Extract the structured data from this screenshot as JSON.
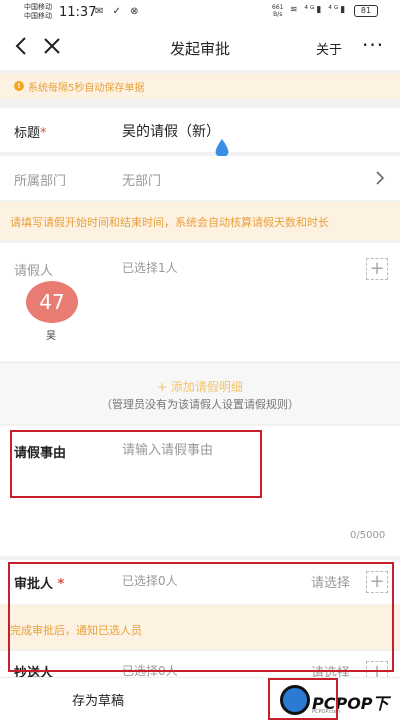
{
  "status_bar": {
    "carrier_1": "中国移动",
    "carrier_2": "中国移动",
    "time": "11:37",
    "speed_value": "661",
    "speed_unit": "B/s",
    "battery": "81"
  },
  "navbar": {
    "title": "发起审批",
    "about": "关于",
    "more": "···"
  },
  "autosave_notice": "系统每隔5秒自动保存单据",
  "form": {
    "title_label": "标题",
    "title_required": "*",
    "title_value": "吴的请假（新）",
    "dept_label": "所属部门",
    "dept_value": "无部门",
    "leave_hint": "请填写请假开始时间和结束时间，系统会自动核算请假天数和时长",
    "applicant_label": "请假人",
    "applicant_selected": "已选择1人",
    "avatar_number": "47",
    "avatar_name": "吴",
    "add_detail": "+ 添加请假明细",
    "add_detail_note": "（管理员没有为该请假人设置请假规则）",
    "reason_label": "请假事由",
    "reason_placeholder": "请输入请假事由",
    "reason_counter": "0/5000",
    "approver_label": "审批人",
    "approver_required": "*",
    "approver_selected": "已选择0人",
    "approver_select": "请选择",
    "approver_hint": "完成审批后，通知已选人员",
    "cc_label": "抄送人",
    "cc_selected": "已选择0人",
    "cc_select": "请选择"
  },
  "bottom": {
    "save_draft": "存为草稿"
  },
  "watermark": {
    "text": "PCPOP下载",
    "sub": "PCPOP.com"
  },
  "colors": {
    "accent_orange": "#e8a13a",
    "required_red": "#e14a3f",
    "avatar_bg": "#e87b72",
    "annotation_red": "#c8202a"
  }
}
